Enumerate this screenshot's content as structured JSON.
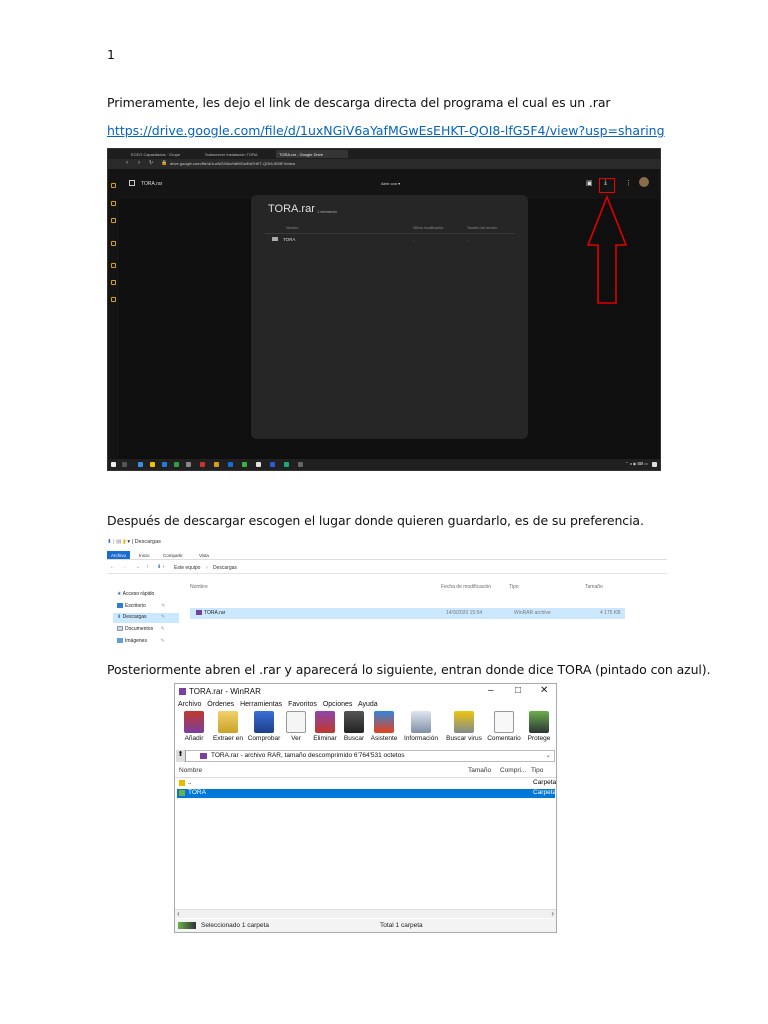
{
  "page": {
    "page_number": "1",
    "intro_text": "Primeramente, les dejo el link de descarga directa del programa el cual es un .rar",
    "link_text": "https://drive.google.com/file/d/1uxNGiV6aYafMGwEsEHKT-QOI8-lfG5F4/view?usp=sharing",
    "after_download_text": "Después de descargar escogen el lugar donde quieren guardarlo, es de su preferencia.",
    "open_rar_text": "Posteriormente abren el .rar y aparecerá lo siguiente, entran donde dice TORA (pintado con azul)."
  },
  "browser": {
    "tabs": [
      "ECEG Capacitados · Drupe",
      "Subscrever Instalación TORA",
      "TORA.rar - Google Drive"
    ],
    "url": "drive.google.com/file/d/1uxNGiV6aYafMGwEsEHKT-QOI8-lfG5F4/view",
    "file_name": "TORA.rar",
    "open_with": "Abrir con",
    "panel_title": "TORA.rar",
    "panel_count": "1 elemento",
    "col_name": "Nombre",
    "col_modified": "Última modificación",
    "col_size": "Tamaño del archivo",
    "row_name": "TORA",
    "row_modified": "-",
    "row_size": "-",
    "arrow_color": "#e00000"
  },
  "explorer": {
    "title": "Descargas",
    "ribbon_tabs": [
      "Archivo",
      "Inicio",
      "Compartir",
      "Vista"
    ],
    "breadcrumb": [
      "Este equipo",
      "Descargas"
    ],
    "columns": [
      "Nombre",
      "Fecha de modificación",
      "Tipo",
      "Tamaño"
    ],
    "tree": [
      {
        "label": "Acceso rápido"
      },
      {
        "label": "Escritorio"
      },
      {
        "label": "Descargas"
      },
      {
        "label": "Documentos"
      },
      {
        "label": "Imágenes"
      }
    ],
    "file": {
      "name": "TORA.rar",
      "date": "14/9/2020 15:54",
      "type": "WinRAR archive",
      "size": "4 175 KB"
    }
  },
  "winrar": {
    "title": "TORA.rar - WinRAR",
    "menu": [
      "Archivo",
      "Órdenes",
      "Herramientas",
      "Favoritos",
      "Opciones",
      "Ayuda"
    ],
    "tools": [
      "Añadir",
      "Extraer en",
      "Comprobar",
      "Ver",
      "Eliminar",
      "Buscar",
      "Asistente",
      "Información",
      "Buscar virus",
      "Comentario",
      "Protege"
    ],
    "path": "TORA.rar - archivo RAR, tamaño descomprimido 6'764'531 octetos",
    "columns": [
      "Nombre",
      "Tamaño",
      "Compri...",
      "Tipo"
    ],
    "rows": [
      {
        "name": "..",
        "type": "Carpeta"
      },
      {
        "name": "TORA",
        "type": "Carpeta"
      }
    ],
    "status_left": "Seleccionado 1 carpeta",
    "status_right": "Total 1 carpeta"
  }
}
